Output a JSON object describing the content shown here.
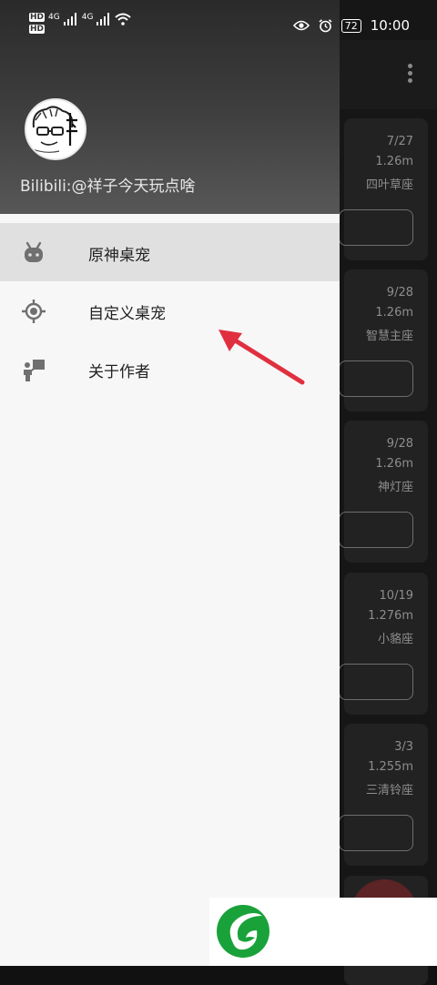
{
  "status_bar": {
    "left_indicators": [
      "HD",
      "HD",
      "4G",
      "4G"
    ],
    "battery": "72",
    "time": "10:00"
  },
  "drawer": {
    "header": {
      "avatar_icon": "avatar-sketch-icon",
      "name": "Bilibili:@祥子今天玩点啥"
    },
    "items": [
      {
        "label": "原神桌宠",
        "icon": "android-robot-icon",
        "active": true
      },
      {
        "label": "自定义桌宠",
        "icon": "crosshair-target-icon",
        "active": false
      },
      {
        "label": "关于作者",
        "icon": "person-board-icon",
        "active": false
      }
    ]
  },
  "background_cards": [
    {
      "date": "7/27",
      "height": "1.26m",
      "constellation": "四叶草座"
    },
    {
      "date": "9/28",
      "height": "1.26m",
      "constellation": "智慧主座"
    },
    {
      "date": "9/28",
      "height": "1.26m",
      "constellation": "神灯座"
    },
    {
      "date": "10/19",
      "height": "1.276m",
      "constellation": "小貉座"
    },
    {
      "date": "3/3",
      "height": "1.255m",
      "constellation": "三清铃座"
    }
  ],
  "colors": {
    "arrow": "#e03040",
    "logo_green": "#1aa23a",
    "active_item_bg": "#e0e0e0"
  }
}
